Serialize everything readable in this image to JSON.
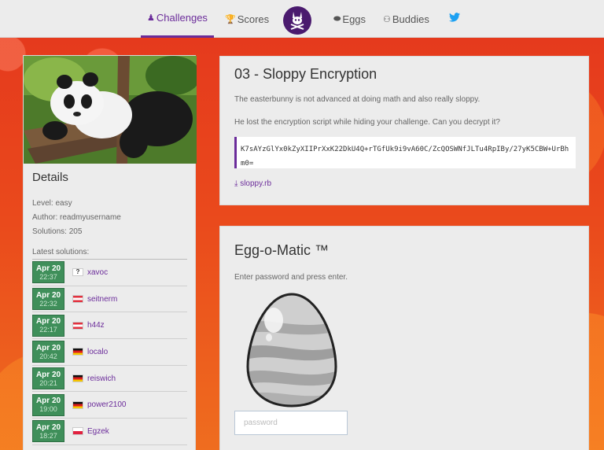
{
  "nav": {
    "challenges": "Challenges",
    "scores": "Scores",
    "eggs": "Eggs",
    "buddies": "Buddies"
  },
  "sidebar": {
    "details_title": "Details",
    "level": "Level: easy",
    "author": "Author: readmyusername",
    "solutions": "Solutions: 205",
    "latest_title": "Latest solutions:",
    "entries": [
      {
        "date": "Apr 20",
        "time": "22:37",
        "flag": "unknown",
        "user": "xavoc"
      },
      {
        "date": "Apr 20",
        "time": "22:32",
        "flag": "at",
        "user": "seitnerm"
      },
      {
        "date": "Apr 20",
        "time": "22:17",
        "flag": "at",
        "user": "h44z"
      },
      {
        "date": "Apr 20",
        "time": "20:42",
        "flag": "de",
        "user": "localo"
      },
      {
        "date": "Apr 20",
        "time": "20:21",
        "flag": "de",
        "user": "reiswich"
      },
      {
        "date": "Apr 20",
        "time": "19:00",
        "flag": "de",
        "user": "power2100"
      },
      {
        "date": "Apr 20",
        "time": "18:27",
        "flag": "pl",
        "user": "Egzek"
      }
    ]
  },
  "challenge": {
    "title": "03 - Sloppy Encryption",
    "desc1": "The easterbunny is not advanced at doing math and also really sloppy.",
    "desc2": "He lost the encryption script while hiding your challenge. Can you decrypt it?",
    "ciphertext": "K7sAYzGlYx0kZyXIIPrXxK22DkU4Q+rTGfUk9i9vA60C/ZcQOSWNfJLTu4RpIBy/27yK5CBW+UrBhm0=",
    "download": "sloppy.rb"
  },
  "egg": {
    "title": "Egg-o-Matic ™",
    "desc": "Enter password and press enter.",
    "password_placeholder": "password"
  },
  "colors": {
    "accent": "#6b2c9a",
    "date_badge": "#3f8f5a",
    "background": "#e8401a"
  }
}
